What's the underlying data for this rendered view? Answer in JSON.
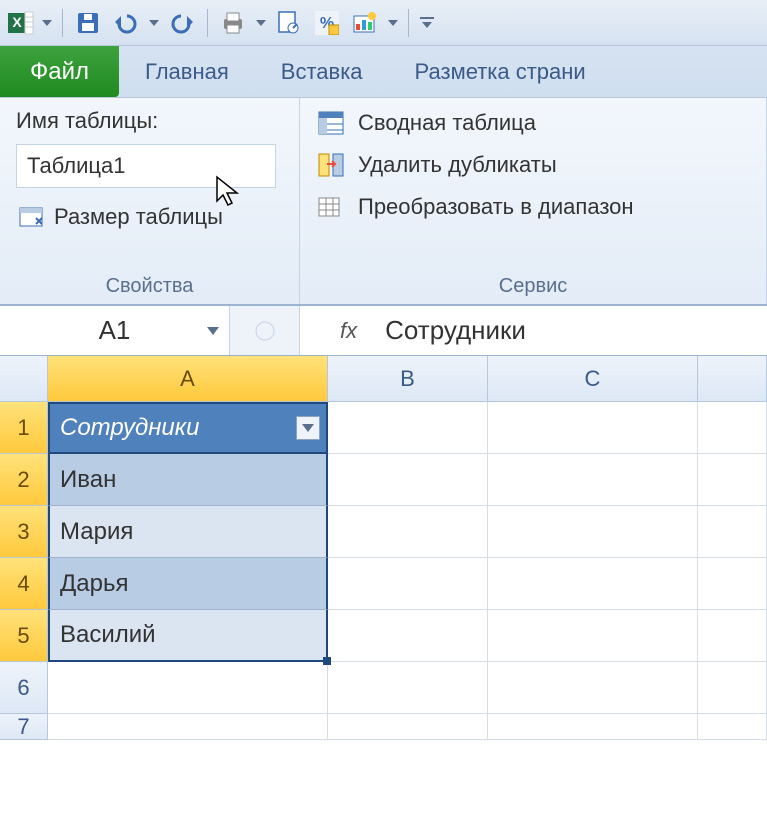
{
  "qat": {
    "excel_letter": "X"
  },
  "tabs": {
    "file": "Файл",
    "home": "Главная",
    "insert": "Вставка",
    "layout": "Разметка страни"
  },
  "ribbon": {
    "properties": {
      "table_name_label": "Имя таблицы:",
      "table_name_value": "Таблица1",
      "resize_table": "Размер таблицы",
      "group_label": "Свойства"
    },
    "tools": {
      "pivot": "Сводная таблица",
      "dedup": "Удалить дубликаты",
      "convert": "Преобразовать в диапазон",
      "group_label": "Сервис"
    }
  },
  "formula_bar": {
    "name_box": "A1",
    "fx_label": "fx",
    "content": "Сотрудники"
  },
  "grid": {
    "columns": [
      "A",
      "B",
      "C"
    ],
    "active_col": "A",
    "rows": [
      "1",
      "2",
      "3",
      "4",
      "5",
      "6",
      "7"
    ],
    "active_rows": [
      "1",
      "2",
      "3",
      "4",
      "5"
    ],
    "table_header": "Сотрудники",
    "table_data": [
      "Иван",
      "Мария",
      "Дарья",
      "Василий"
    ]
  }
}
